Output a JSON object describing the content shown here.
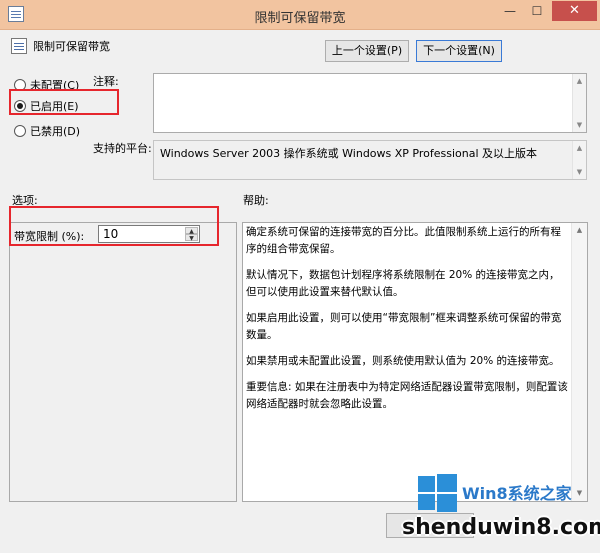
{
  "window": {
    "title": "限制可保留带宽",
    "minimize_glyph": "—",
    "maximize_glyph": "☐",
    "close_glyph": "✕"
  },
  "header": {
    "policy_name": "限制可保留带宽",
    "prev_label": "上一个设置(P)",
    "next_label": "下一个设置(N)"
  },
  "state": {
    "options": [
      {
        "label": "未配置(C)",
        "checked": false
      },
      {
        "label": "已启用(E)",
        "checked": true
      },
      {
        "label": "已禁用(D)",
        "checked": false
      }
    ]
  },
  "comment": {
    "label": "注释:",
    "value": ""
  },
  "platform": {
    "label": "支持的平台:",
    "value": "Windows Server 2003 操作系统或 Windows XP Professional 及以上版本"
  },
  "options_section": {
    "label": "选项:",
    "bandwidth_label": "带宽限制 (%):",
    "bandwidth_value": "10"
  },
  "help_section": {
    "label": "帮助:",
    "paragraphs": [
      "确定系统可保留的连接带宽的百分比。此值限制系统上运行的所有程序的组合带宽保留。",
      "默认情况下，数据包计划程序将系统限制在 20% 的连接带宽之内，但可以使用此设置来替代默认值。",
      "如果启用此设置，则可以使用“带宽限制”框来调整系统可保留的带宽数量。",
      "如果禁用或未配置此设置，则系统使用默认值为 20% 的连接带宽。",
      "重要信息: 如果在注册表中为特定网络适配器设置带宽限制，则配置该网络适配器时就会忽略此设置。"
    ]
  },
  "watermark": {
    "brand": "Win8系统之家",
    "url": "shenduwin8.com"
  },
  "colors": {
    "titlebar": "#f2c4a0",
    "close_button": "#c7504c",
    "highlight_box": "#e6262d",
    "watermark_blue": "#2b8fd8"
  }
}
